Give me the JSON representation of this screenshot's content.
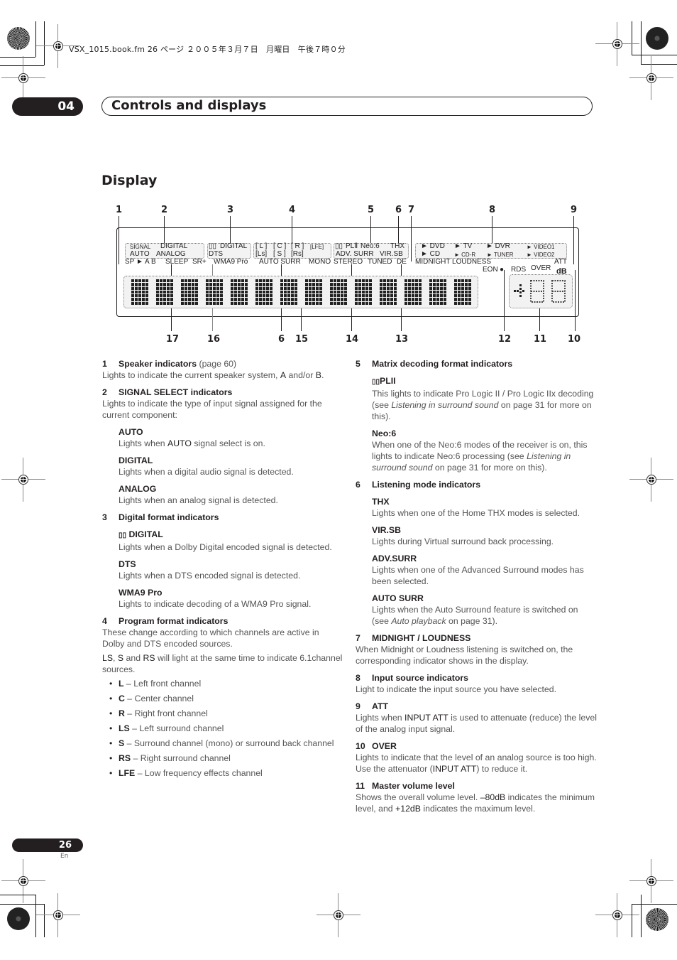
{
  "print_header": "VSX_1015.book.fm  26 ページ  ２００５年３月７日　月曜日　午後７時０分",
  "chapter": {
    "number": "04",
    "title": "Controls and displays"
  },
  "section_title": "Display",
  "diagram": {
    "callouts_top": [
      "1",
      "2",
      "3",
      "4",
      "5",
      "6",
      "7",
      "8",
      "9"
    ],
    "callouts_bottom": [
      "17",
      "16",
      "6",
      "15",
      "14",
      "13",
      "12",
      "11",
      "10"
    ],
    "indicators": {
      "signal": "SIGNAL",
      "digital": "DIGITAL",
      "auto": "AUTO",
      "analog": "ANALOG",
      "dd_digital": "DIGITAL",
      "dts": "DTS",
      "l": "[ L ]",
      "c": "[ C ]",
      "r": "[ R ]",
      "lfe": "[LFE]",
      "ls": "[Ls]",
      "s": "[ S ]",
      "rs": "[Rs]",
      "pl2": "PLⅡ",
      "neo6": "Neo:6",
      "thx": "THX",
      "adv_surr": "ADV. SURR",
      "vir_sb": "VIR.SB",
      "sp_ab": "SP ► A B",
      "sleep": "SLEEP",
      "sr_plus": "SR+",
      "wma9": "WMA9 Pro",
      "auto_surr": "AUTO  SURR",
      "mono": "MONO",
      "stereo": "STEREO",
      "tuned": "TUNED",
      "de": "DE",
      "dvd": "► DVD",
      "tv": "► TV",
      "dvr": "►  DVR",
      "video1": "► VIDEO1",
      "cd": "►  CD",
      "cdr": "► CD-R",
      "tuner": "► TUNER",
      "video2": "► VIDEO2",
      "midnight_loudness": "MIDNIGHT LOUDNESS",
      "att": "ATT",
      "eon": "EON",
      "rds": "RDS",
      "over": "OVER",
      "db": "dB"
    }
  },
  "left_column": {
    "s1": {
      "num": "1",
      "title": "Speaker indicators",
      "ref": "(page 60)",
      "text_a": "Lights to indicate the current speaker system, ",
      "bold_a": "A",
      "text_b": " and/or ",
      "bold_b": "B",
      "text_c": "."
    },
    "s2": {
      "num": "2",
      "title": "SIGNAL SELECT indicators",
      "text": "Lights to indicate the type of input signal assigned for the current component:",
      "items": [
        {
          "title": "AUTO",
          "pre": "Lights when ",
          "bold": "AUTO",
          "post": " signal select is on."
        },
        {
          "title": "DIGITAL",
          "text": "Lights when a digital audio signal is detected."
        },
        {
          "title": "ANALOG",
          "text": "Lights when an analog signal is detected."
        }
      ]
    },
    "s3": {
      "num": "3",
      "title": "Digital format indicators",
      "items": [
        {
          "title": "DIGITAL",
          "text": "Lights when a Dolby Digital encoded signal is detected."
        },
        {
          "title": "DTS",
          "text": "Lights when a DTS encoded signal is detected."
        },
        {
          "title": "WMA9 Pro",
          "text": "Lights to indicate decoding of a WMA9 Pro signal."
        }
      ]
    },
    "s4": {
      "num": "4",
      "title": "Program format indicators",
      "text": "These change according to which channels are active in Dolby and DTS encoded sources.",
      "note_ls": "LS",
      "note_s": "S",
      "note_rs": "RS",
      "note_and": " and ",
      "note_comma": ", ",
      "note_rest": " will light at the same time to indicate 6.1channel sources.",
      "channels": [
        {
          "key": "L",
          "desc": " – Left front channel"
        },
        {
          "key": "C",
          "desc": " – Center channel"
        },
        {
          "key": "R",
          "desc": " – Right front channel"
        },
        {
          "key": "LS",
          "desc": " – Left surround channel"
        },
        {
          "key": "S",
          "desc": " – Surround channel (mono) or surround back channel"
        },
        {
          "key": "RS",
          "desc": " – Right surround channel"
        },
        {
          "key": "LFE",
          "desc": " – Low frequency effects channel"
        }
      ]
    }
  },
  "right_column": {
    "s5": {
      "num": "5",
      "title": "Matrix decoding format indicators",
      "pl2_title": "PLII",
      "pl2_text_a": "This lights to indicate Pro Logic II / Pro Logic IIx decoding (see ",
      "pl2_italic": "Listening in surround sound",
      "pl2_text_b": " on page 31 for more on this).",
      "neo_title": "Neo:6",
      "neo_text_a": "When one of the Neo:6 modes of the receiver is on, this lights to indicate Neo:6 processing (see ",
      "neo_italic": "Listening in surround sound",
      "neo_text_b": " on page 31 for more on this)."
    },
    "s6": {
      "num": "6",
      "title": "Listening mode indicators",
      "items": [
        {
          "title": "THX",
          "text": "Lights when one of the Home THX modes is selected."
        },
        {
          "title": "VIR.SB",
          "text": "Lights during Virtual surround back processing."
        },
        {
          "title": "ADV.SURR",
          "text": "Lights when one of the Advanced Surround modes has been selected."
        }
      ],
      "auto_title": "AUTO SURR",
      "auto_text_a": "Lights when the Auto Surround feature is switched on (see ",
      "auto_italic": "Auto playback",
      "auto_text_b": " on page 31)."
    },
    "s7": {
      "num": "7",
      "title": "MIDNIGHT / LOUDNESS",
      "text": "When Midnight or Loudness listening is switched on, the corresponding indicator shows in the display."
    },
    "s8": {
      "num": "8",
      "title": "Input source indicators",
      "text": "Light to indicate the input source you have selected."
    },
    "s9": {
      "num": "9",
      "title": "ATT",
      "pre": "Lights when ",
      "bold": "INPUT ATT",
      "post": " is used to attenuate (reduce) the level of the analog input signal."
    },
    "s10": {
      "num": "10",
      "title": "OVER",
      "pre": "Lights to indicate that the level of an analog source is too high. Use the attenuator (",
      "bold": "INPUT ATT",
      "post": ") to reduce it."
    },
    "s11": {
      "num": "11",
      "title": "Master volume level",
      "pre": "Shows the overall volume level. ",
      "bold_a": "–80dB",
      "mid": " indicates the minimum level, and ",
      "bold_b": "+12dB",
      "post": " indicates the maximum level."
    }
  },
  "footer": {
    "page_number": "26",
    "language": "En"
  }
}
